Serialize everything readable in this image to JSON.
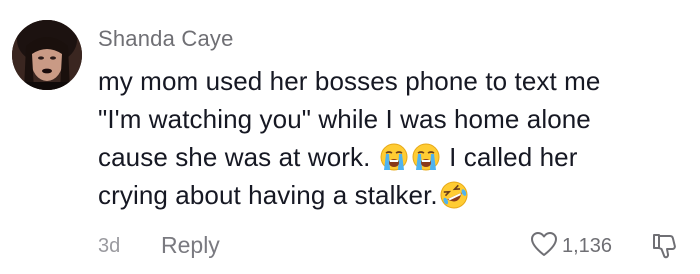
{
  "comment": {
    "username": "Shanda Caye",
    "lines": [
      "my mom used her bosses phone to text me",
      "\"I'm watching you\" while I was home alone",
      "cause she was at work.",
      "I called her",
      "crying about having a stalker."
    ],
    "emojis": [
      "loudly-crying-face",
      "loudly-crying-face",
      "rolling-on-floor-laughing"
    ],
    "time": "3d",
    "reply_label": "Reply",
    "like_count": "1,136"
  },
  "icons": {
    "like": "heart-outline-icon",
    "dislike": "thumbs-down-outline-icon"
  },
  "colors": {
    "username": "#6f6f74",
    "text": "#161823",
    "muted": "#9a9a9f"
  }
}
